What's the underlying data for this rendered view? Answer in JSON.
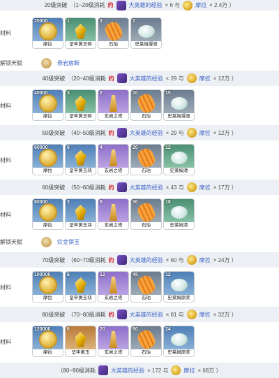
{
  "sections": [
    {
      "band": {
        "level": "20级突破",
        "range": "（1~20级消耗",
        "about": "约",
        "exp_name": "大英雄的经验",
        "exp_qty": "× 6 与",
        "mora_name": "摩拉",
        "mora_qty": "× 2.4万 ）"
      },
      "label": "材料",
      "items": [
        {
          "count": "20000",
          "name": "摩拉",
          "icon": "coin",
          "rarity": "r3"
        },
        {
          "count": "1",
          "name": "坚牢黄玉碎",
          "icon": "jade",
          "rarity": "r2"
        },
        {
          "count": "3",
          "name": "石珀",
          "icon": "amber",
          "rarity": "r1"
        },
        {
          "count": "3",
          "name": "史莱姆凝液",
          "icon": "slime",
          "rarity": "r1"
        }
      ]
    },
    {
      "band": {
        "level": "40级突破",
        "range": "（20~40级消耗",
        "about": "约",
        "exp_name": "大英雄的经验",
        "exp_qty": "× 29 与",
        "mora_name": "摩拉",
        "mora_qty": "× 12万 ）"
      },
      "label": "材料",
      "items": [
        {
          "count": "40000",
          "name": "摩拉",
          "icon": "coin",
          "rarity": "r3"
        },
        {
          "count": "3",
          "name": "坚牢黄玉碎",
          "icon": "jade",
          "rarity": "r2"
        },
        {
          "count": "2",
          "name": "玄岩之塔",
          "icon": "tower",
          "rarity": "r4"
        },
        {
          "count": "10",
          "name": "石珀",
          "icon": "amber",
          "rarity": "r1"
        },
        {
          "count": "15",
          "name": "史莱姆凝液",
          "icon": "slime",
          "rarity": "r1"
        }
      ]
    },
    {
      "band": {
        "level": "50级突破",
        "range": "（40~50级消耗",
        "about": "约",
        "exp_name": "大英雄的经验",
        "exp_qty": "× 29 与",
        "mora_name": "摩拉",
        "mora_qty": "× 12万 ）"
      },
      "label": "材料",
      "items": [
        {
          "count": "60000",
          "name": "摩拉",
          "icon": "coin",
          "rarity": "r3"
        },
        {
          "count": "6",
          "name": "坚牢黄玉块",
          "icon": "jade",
          "rarity": "r3"
        },
        {
          "count": "4",
          "name": "玄岩之塔",
          "icon": "tower",
          "rarity": "r4"
        },
        {
          "count": "20",
          "name": "石珀",
          "icon": "amber",
          "rarity": "r1"
        },
        {
          "count": "12",
          "name": "史莱姆清",
          "icon": "slime",
          "rarity": "r2"
        }
      ]
    },
    {
      "band": {
        "level": "60级突破",
        "range": "（50~60级消耗",
        "about": "约",
        "exp_name": "大英雄的经验",
        "exp_qty": "× 43 与",
        "mora_name": "摩拉",
        "mora_qty": "× 17万 ）"
      },
      "label": "材料",
      "items": [
        {
          "count": "80000",
          "name": "摩拉",
          "icon": "coin",
          "rarity": "r3"
        },
        {
          "count": "3",
          "name": "坚牢黄玉块",
          "icon": "jade",
          "rarity": "r3"
        },
        {
          "count": "8",
          "name": "玄岩之塔",
          "icon": "tower",
          "rarity": "r4"
        },
        {
          "count": "30",
          "name": "石珀",
          "icon": "amber",
          "rarity": "r1"
        },
        {
          "count": "18",
          "name": "史莱姆清",
          "icon": "slime",
          "rarity": "r2"
        }
      ]
    },
    {
      "band": {
        "level": "70级突破",
        "range": "（60~70级消耗",
        "about": "约",
        "exp_name": "大英雄的经验",
        "exp_qty": "× 60 与",
        "mora_name": "摩拉",
        "mora_qty": "× 24万 ）"
      },
      "label": "材料",
      "items": [
        {
          "count": "100000",
          "name": "摩拉",
          "icon": "coin",
          "rarity": "r3"
        },
        {
          "count": "6",
          "name": "坚牢黄玉块",
          "icon": "jade",
          "rarity": "r3"
        },
        {
          "count": "12",
          "name": "玄岩之塔",
          "icon": "tower",
          "rarity": "r4"
        },
        {
          "count": "45",
          "name": "石珀",
          "icon": "amber",
          "rarity": "r1"
        },
        {
          "count": "12",
          "name": "史莱姆原浆",
          "icon": "slime",
          "rarity": "r3"
        }
      ]
    },
    {
      "band": {
        "level": "80级突破",
        "range": "（70~80级消耗",
        "about": "约",
        "exp_name": "大英雄的经验",
        "exp_qty": "× 81 与",
        "mora_name": "摩拉",
        "mora_qty": "× 32万 ）"
      },
      "label": "材料",
      "items": [
        {
          "count": "120000",
          "name": "摩拉",
          "icon": "coin",
          "rarity": "r3"
        },
        {
          "count": "6",
          "name": "坚牢黄玉",
          "icon": "jade",
          "rarity": "r5"
        },
        {
          "count": "20",
          "name": "玄岩之塔",
          "icon": "tower",
          "rarity": "r4"
        },
        {
          "count": "60",
          "name": "石珀",
          "icon": "amber",
          "rarity": "r1"
        },
        {
          "count": "24",
          "name": "史莱姆原浆",
          "icon": "slime",
          "rarity": "r3"
        }
      ]
    }
  ],
  "talents": [
    {
      "label": "解锁天赋",
      "name": "悬岩宸断"
    },
    {
      "label": "解锁天赋",
      "name": "炊金馔玉"
    }
  ],
  "final_band": {
    "range": "（80~90级消耗",
    "exp_name": "大英雄的经验",
    "exp_qty": "× 172 与",
    "mora_name": "摩拉",
    "mora_qty": "× 68万 ）"
  }
}
